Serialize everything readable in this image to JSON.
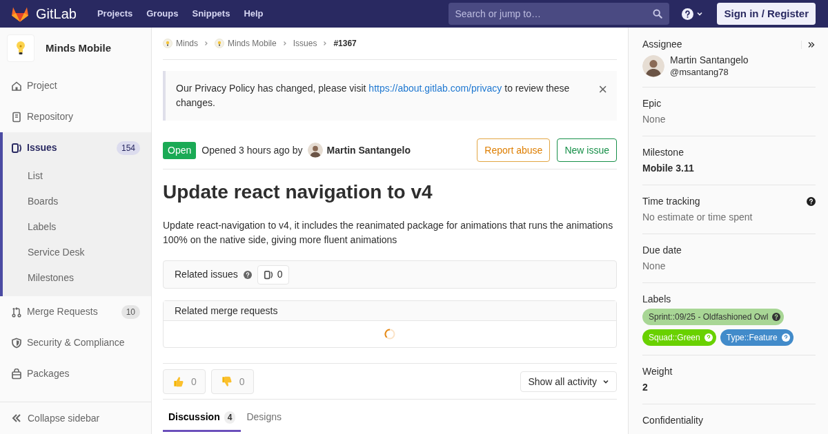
{
  "navbar": {
    "brand": "GitLab",
    "links": [
      "Projects",
      "Groups",
      "Snippets",
      "Help"
    ],
    "search": {
      "placeholder": "Search or jump to…"
    },
    "sign_in": "Sign in / Register"
  },
  "sidebar": {
    "project": "Minds Mobile",
    "items": [
      {
        "kind": "project",
        "label": "Project",
        "selected": false
      },
      {
        "kind": "repository",
        "label": "Repository",
        "selected": false
      },
      {
        "kind": "issues",
        "label": "Issues",
        "count": "154",
        "selected": true,
        "children": [
          {
            "label": "List"
          },
          {
            "label": "Boards"
          },
          {
            "label": "Labels"
          },
          {
            "label": "Service Desk"
          },
          {
            "label": "Milestones"
          }
        ]
      },
      {
        "kind": "merge",
        "label": "Merge Requests",
        "count": "10",
        "selected": false
      },
      {
        "kind": "security",
        "label": "Security & Compliance",
        "selected": false
      },
      {
        "kind": "packages",
        "label": "Packages",
        "selected": false
      }
    ],
    "collapse": "Collapse sidebar"
  },
  "breadcrumbs": [
    {
      "label": "Minds",
      "avatar": true,
      "current": false
    },
    {
      "label": "Minds Mobile",
      "avatar": true,
      "current": false
    },
    {
      "label": "Issues",
      "avatar": false,
      "current": false
    },
    {
      "label": "#1367",
      "avatar": false,
      "current": true
    }
  ],
  "alert": {
    "before": "Our Privacy Policy has changed, please visit",
    "link": "https://about.gitlab.com/privacy",
    "after": "to review these changes.",
    "close": "×"
  },
  "issue": {
    "status": "Open",
    "opened": "Opened 3 hours ago by",
    "author": "Martin Santangelo",
    "buttons": [
      {
        "kind": "warning",
        "label": "Report abuse"
      },
      {
        "kind": "success",
        "label": "New issue"
      }
    ],
    "title": "Update react navigation to v4",
    "description": "Update react-navigation to v4, it includes the reanimated package for animations that runs the animations 100% on the native side, giving more fluent animations"
  },
  "related_issues": {
    "title": "Related issues",
    "count": "0"
  },
  "related_merge_requests": {
    "title": "Related merge requests",
    "loading": true
  },
  "awards": [
    {
      "kind": "thumbsup",
      "count": "0"
    },
    {
      "kind": "thumbsdown",
      "count": "0"
    }
  ],
  "activity_filter": "Show all activity",
  "tabs": [
    {
      "label": "Discussion",
      "count": "4",
      "selected": true
    },
    {
      "label": "Designs",
      "selected": false
    }
  ],
  "right_sidebar": {
    "assignee": {
      "heading": "Assignee",
      "name": "Martin Santangelo",
      "username": "@msantang78"
    },
    "sections": [
      {
        "kind": "muted",
        "heading": "Epic",
        "value": "None",
        "help": false
      },
      {
        "kind": "bold",
        "heading": "Milestone",
        "value": "Mobile 3.11",
        "help": false
      },
      {
        "kind": "muted",
        "heading": "Time tracking",
        "value": "No estimate or time spent",
        "help": true
      },
      {
        "kind": "muted",
        "heading": "Due date",
        "value": "None",
        "help": false
      },
      {
        "kind": "labels",
        "heading": "Labels",
        "help": false,
        "labels": [
          {
            "text": "Sprint::09/25 - Oldfashioned Owl",
            "color": "#a8d695"
          },
          {
            "text": "Squad::Green",
            "color": "#69d100"
          },
          {
            "text": "Type::Feature",
            "color": "#428bca"
          }
        ]
      },
      {
        "kind": "bold",
        "heading": "Weight",
        "value": "2",
        "help": false
      },
      {
        "kind": "heading",
        "heading": "Confidentiality",
        "help": false
      }
    ]
  }
}
